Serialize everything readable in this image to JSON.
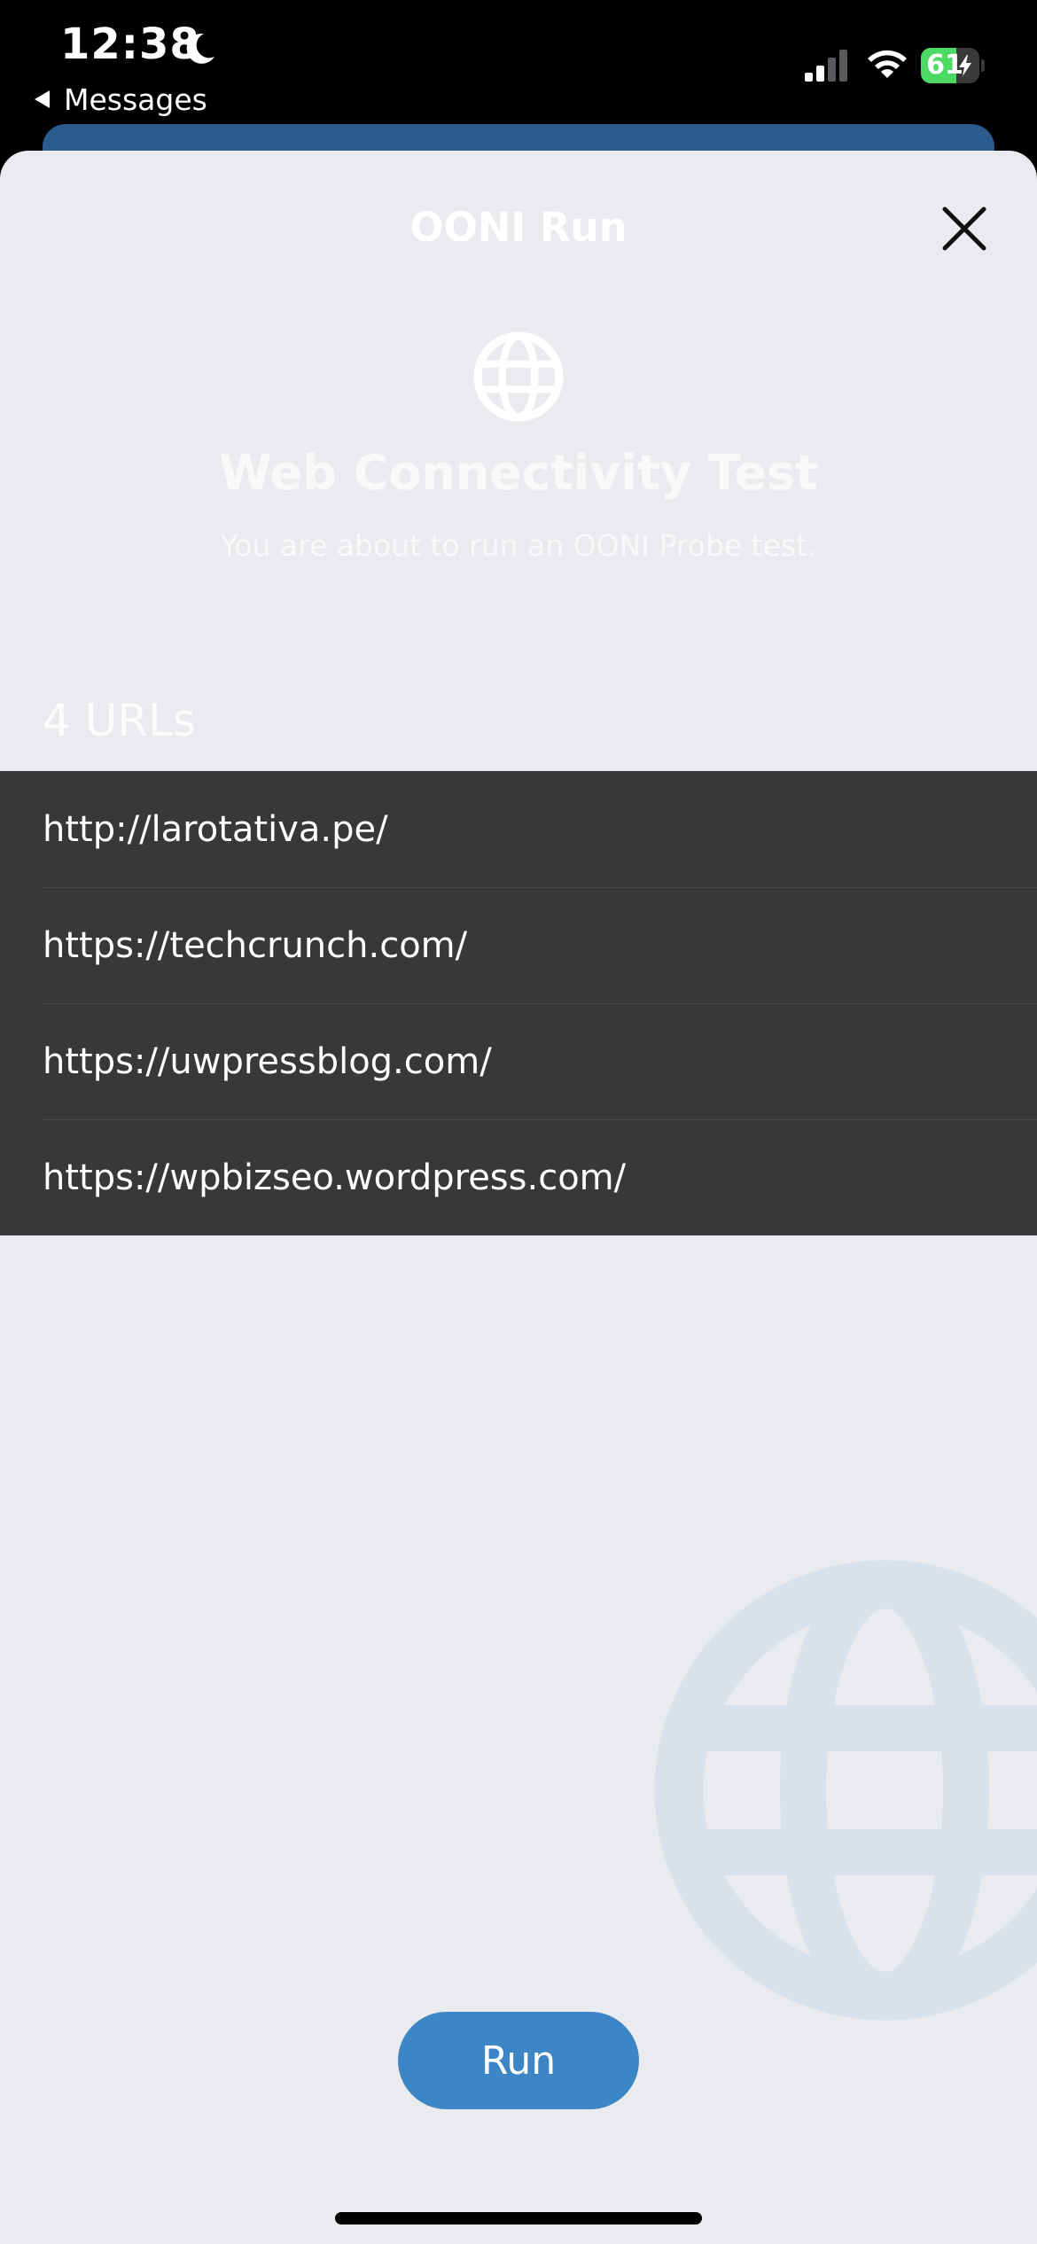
{
  "status_bar": {
    "time": "12:38",
    "back_label": "Messages",
    "battery_level": "61",
    "battery_fraction": 0.61,
    "icons": [
      "moon-icon",
      "signal-icon",
      "wifi-icon",
      "battery-icon",
      "charging-bolt-icon"
    ]
  },
  "sheet": {
    "title": "OONI Run",
    "close_icon": "close-icon",
    "header_icon": "globe-icon",
    "test_title": "Web Connectivity Test",
    "test_subtitle": "You are about to run an OONI Probe test.",
    "urls_count": "4 URLs",
    "urls": [
      "http://larotativa.pe/",
      "https://techcrunch.com/",
      "https://uwpressblog.com/",
      "https://wpbizseo.wordpress.com/"
    ],
    "run_label": "Run",
    "background_icon": "globe-watermark-icon"
  },
  "colors": {
    "sheet_background": "#e9ebee",
    "url_list_background": "#38383b",
    "run_button": "#3d86c6",
    "watermark": "#d9e1ea",
    "behind_card": "#2b5b8c"
  }
}
